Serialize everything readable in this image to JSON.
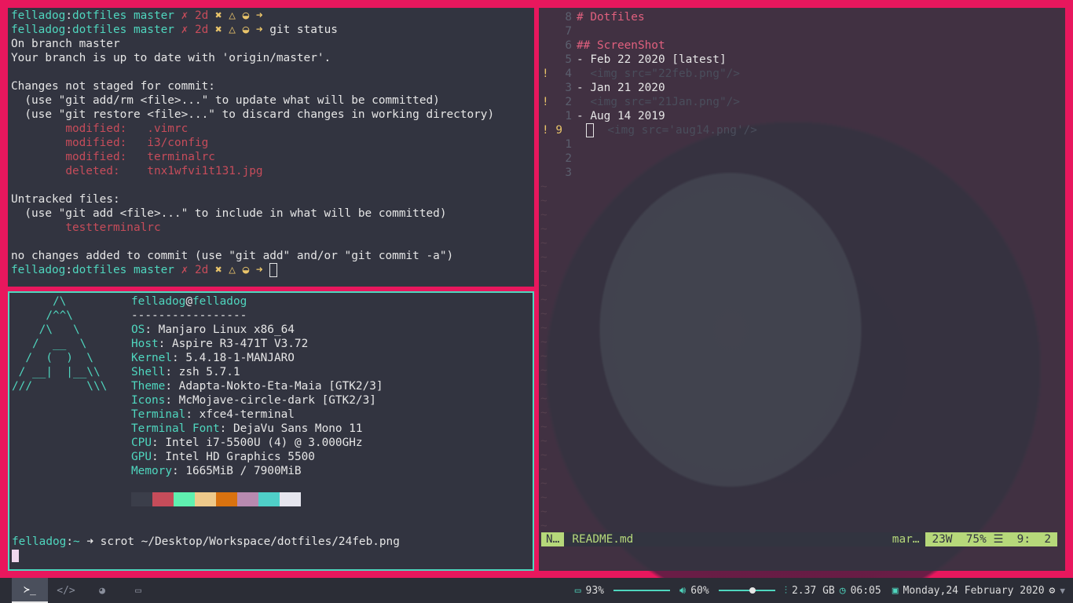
{
  "git_prompt": {
    "user": "felladog",
    "dir": "dotfiles",
    "branch": "master",
    "flags": "✗ 2d",
    "marks": "✖ △ ◒ ➜",
    "command": "git status"
  },
  "git_status": {
    "line1": "On branch master",
    "line2": "Your branch is up to date with 'origin/master'.",
    "line3": "Changes not staged for commit:",
    "line4": "  (use \"git add/rm <file>...\" to update what will be committed)",
    "line5": "  (use \"git restore <file>...\" to discard changes in working directory)",
    "changes": [
      {
        "status": "modified:",
        "file": ".vimrc"
      },
      {
        "status": "modified:",
        "file": "i3/config"
      },
      {
        "status": "modified:",
        "file": "terminalrc"
      },
      {
        "status": "deleted:",
        "file": "tnx1wfvi1t131.jpg"
      }
    ],
    "untracked_header": "Untracked files:",
    "untracked_hint": "  (use \"git add <file>...\" to include in what will be committed)",
    "untracked_file": "testterminalrc",
    "footer": "no changes added to commit (use \"git add\" and/or \"git commit -a\")"
  },
  "neofetch": {
    "logo": [
      "      /\\",
      "     /^^\\",
      "    /\\   \\",
      "   /  __  \\",
      "  /  (  )  \\",
      " / __|  |__\\\\",
      "///        \\\\\\"
    ],
    "user": "felladog",
    "host": "felladog",
    "separator": "-----------------",
    "fields": [
      {
        "key": "OS",
        "value": "Manjaro Linux x86_64"
      },
      {
        "key": "Host",
        "value": "Aspire R3-471T V3.72"
      },
      {
        "key": "Kernel",
        "value": "5.4.18-1-MANJARO"
      },
      {
        "key": "Shell",
        "value": "zsh 5.7.1"
      },
      {
        "key": "Theme",
        "value": "Adapta-Nokto-Eta-Maia [GTK2/3]"
      },
      {
        "key": "Icons",
        "value": "McMojave-circle-dark [GTK2/3]"
      },
      {
        "key": "Terminal",
        "value": "xfce4-terminal"
      },
      {
        "key": "Terminal Font",
        "value": "DejaVu Sans Mono 11"
      },
      {
        "key": "CPU",
        "value": "Intel i7-5500U (4) @ 3.000GHz"
      },
      {
        "key": "GPU",
        "value": "Intel HD Graphics 5500"
      },
      {
        "key": "Memory",
        "value": "1665MiB / 7900MiB"
      }
    ],
    "swatches": [
      "#3b3e4a",
      "#c64c5a",
      "#5ff0b0",
      "#eec98a",
      "#d9720f",
      "#b88ab0",
      "#4fcfc8",
      "#e6e6ef"
    ]
  },
  "term2_prompt": {
    "user": "felladog",
    "dir": "~",
    "arrow": "➜",
    "command": "scrot ~/Desktop/Workspace/dotfiles/24feb.png"
  },
  "vim": {
    "lines": [
      {
        "sign": "",
        "num": "8",
        "text": "# Dotfiles",
        "style": "h"
      },
      {
        "sign": "",
        "num": "7",
        "text": "",
        "style": "t"
      },
      {
        "sign": "",
        "num": "6",
        "text": "## ScreenShot",
        "style": "h"
      },
      {
        "sign": "",
        "num": "5",
        "text": "- Feb 22 2020 [latest]",
        "style": "t"
      },
      {
        "sign": "!",
        "num": "4",
        "text": "  <img src=\"22feb.png\"/>",
        "style": "c"
      },
      {
        "sign": "",
        "num": "3",
        "text": "- Jan 21 2020",
        "style": "t"
      },
      {
        "sign": "!",
        "num": "2",
        "text": "  <img src=\"21Jan.png\"/>",
        "style": "c"
      },
      {
        "sign": "",
        "num": "1",
        "text": "- Aug 14 2019",
        "style": "t"
      },
      {
        "sign": "! 9",
        "num": "",
        "text": "  <img src='aug14.png'/>",
        "style": "cur"
      },
      {
        "sign": "",
        "num": "1",
        "text": "",
        "style": "t"
      },
      {
        "sign": "",
        "num": "2",
        "text": "",
        "style": "t"
      },
      {
        "sign": "",
        "num": "3",
        "text": "",
        "style": "t"
      }
    ],
    "tilde_count": 25,
    "status": {
      "mode": "N…",
      "file": "README.md",
      "filetype": "mar…",
      "words": "23W",
      "percent": "75%",
      "menu": "☰",
      "position": "9:  2"
    }
  },
  "taskbar": {
    "workspaces": [
      {
        "icon": "terminal-icon",
        "glyph": "≻_",
        "active": true
      },
      {
        "icon": "code-icon",
        "glyph": "</>",
        "active": false
      },
      {
        "icon": "browser-icon",
        "glyph": "◕",
        "active": false
      },
      {
        "icon": "folder-icon",
        "glyph": "▭",
        "active": false
      }
    ],
    "battery": "93%",
    "volume": "60%",
    "volume_level": 0.6,
    "brightness_level": 1.0,
    "memory": "2.37 GB",
    "time": "06:05",
    "date": "Monday,24 February 2020"
  }
}
